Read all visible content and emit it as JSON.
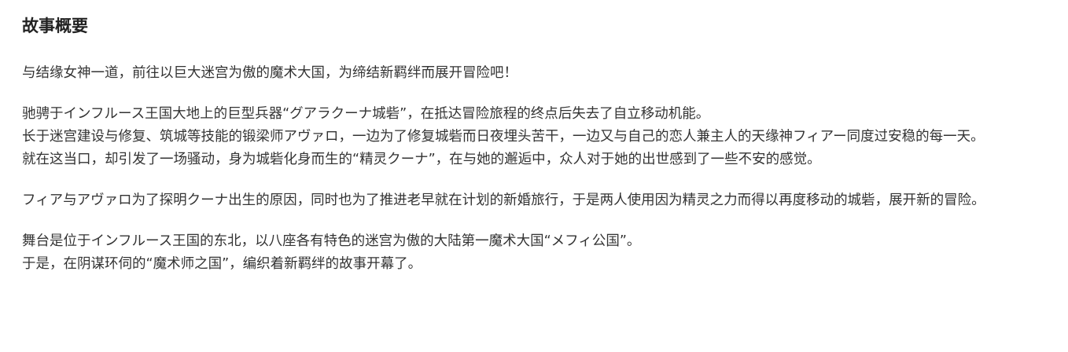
{
  "section": {
    "title": "故事概要",
    "paragraphs": [
      [
        "与结缘女神一道，前往以巨大迷宫为傲的魔术大国，为缔结新羁绊而展开冒险吧！"
      ],
      [
        "驰骋于インフルース王国大地上的巨型兵器“グアラクーナ城砦”，在抵达冒险旅程的终点后失去了自立移动机能。",
        "长于迷宫建设与修复、筑城等技能的锻梁师アヴァロ，一边为了修复城砦而日夜埋头苦干，一边又与自己的恋人兼主人的天缘神フィアー同度过安稳的每一天。",
        "就在这当口，却引发了一场骚动，身为城砦化身而生的“精灵クーナ”，在与她的邂逅中，众人对于她的出世感到了一些不安的感觉。"
      ],
      [
        "フィア与アヴァロ为了探明クーナ出生的原因，同时也为了推进老早就在计划的新婚旅行，于是两人使用因为精灵之力而得以再度移动的城砦，展开新的冒险。"
      ],
      [
        "舞台是位于インフルース王国的东北，以八座各有特色的迷宫为傲的大陆第一魔术大国“メフィ公国”。",
        "于是，在阴谋环伺的“魔术师之国”，编织着新羁绊的故事开幕了。"
      ]
    ]
  }
}
